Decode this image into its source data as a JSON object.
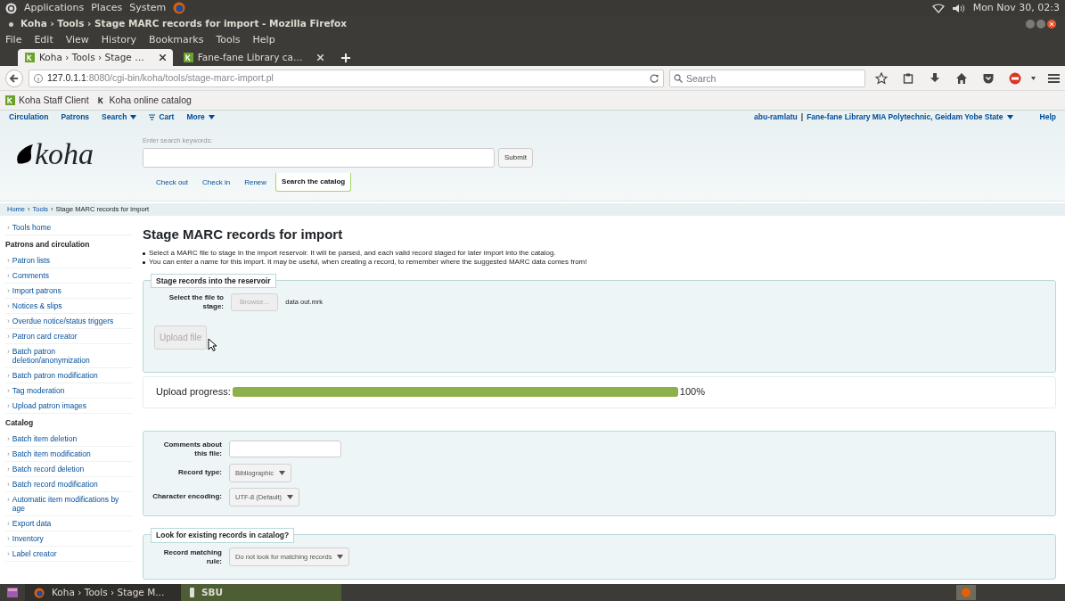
{
  "top_panel": {
    "menus": [
      "Applications",
      "Places",
      "System"
    ],
    "clock": "Mon Nov 30, 02:3"
  },
  "window": {
    "title": "Koha › Tools › Stage MARC records for import - Mozilla Firefox"
  },
  "menu_bar": [
    "File",
    "Edit",
    "View",
    "History",
    "Bookmarks",
    "Tools",
    "Help"
  ],
  "browser_tabs": [
    {
      "label": "Koha › Tools › Stage …",
      "selected": true
    },
    {
      "label": "Fane-fane Library ca…",
      "selected": false
    }
  ],
  "address_bar": {
    "host": "127.0.1.1",
    "path": ":8080/cgi-bin/koha/tools/stage-marc-import.pl"
  },
  "search_bar": {
    "placeholder": "Search"
  },
  "bookmarks": [
    "Koha Staff Client",
    "Koha online catalog"
  ],
  "koha_nav": {
    "left": [
      {
        "label": "Circulation",
        "has_menu": false,
        "kind": "link"
      },
      {
        "label": "Patrons",
        "has_menu": false,
        "kind": "link"
      },
      {
        "label": "Search",
        "has_menu": true,
        "kind": "link"
      },
      {
        "label": "Cart",
        "has_menu": false,
        "kind": "cart"
      },
      {
        "label": "More",
        "has_menu": true,
        "kind": "link"
      }
    ],
    "user": "abu-ramlatu",
    "separator": "|",
    "library": "Fane-fane Library MIA Polytechnic, Geidam Yobe State",
    "help": "Help"
  },
  "header": {
    "logo": "koha",
    "search_label": "Enter search keywords:",
    "submit": "Submit",
    "tabs": [
      {
        "label": "Check out",
        "selected": false
      },
      {
        "label": "Check in",
        "selected": false
      },
      {
        "label": "Renew",
        "selected": false
      },
      {
        "label": "Search the catalog",
        "selected": true
      }
    ]
  },
  "breadcrumb": {
    "separator": "›",
    "items": [
      "Home",
      "Tools",
      "Stage MARC records for import"
    ]
  },
  "sidebar": {
    "marker": "›",
    "items": [
      {
        "kind": "link",
        "label": "Tools home"
      },
      {
        "kind": "heading",
        "label": "Patrons and circulation"
      },
      {
        "kind": "link",
        "label": "Patron lists"
      },
      {
        "kind": "link",
        "label": "Comments"
      },
      {
        "kind": "link",
        "label": "Import patrons"
      },
      {
        "kind": "link",
        "label": "Notices & slips"
      },
      {
        "kind": "link",
        "label": "Overdue notice/status triggers"
      },
      {
        "kind": "link",
        "label": "Patron card creator"
      },
      {
        "kind": "link",
        "label": "Batch patron deletion/anonymization"
      },
      {
        "kind": "link",
        "label": "Batch patron modification"
      },
      {
        "kind": "link",
        "label": "Tag moderation"
      },
      {
        "kind": "link",
        "label": "Upload patron images"
      },
      {
        "kind": "heading",
        "label": "Catalog"
      },
      {
        "kind": "link",
        "label": "Batch item deletion"
      },
      {
        "kind": "link",
        "label": "Batch item modification"
      },
      {
        "kind": "link",
        "label": "Batch record deletion"
      },
      {
        "kind": "link",
        "label": "Batch record modification"
      },
      {
        "kind": "link",
        "label": "Automatic item modifications by age"
      },
      {
        "kind": "link",
        "label": "Export data"
      },
      {
        "kind": "link",
        "label": "Inventory"
      },
      {
        "kind": "link",
        "label": "Label creator"
      }
    ]
  },
  "main": {
    "title": "Stage MARC records for import",
    "notes": [
      "Select a MARC file to stage in the import reservoir. It will be parsed, and each valid record staged for later import into the catalog.",
      "You can enter a name for this import. It may be useful, when creating a record, to remember where the suggested MARC data comes from!"
    ],
    "stage_fieldset": {
      "legend": "Stage records into the reservoir",
      "file_label": "Select the file to stage:",
      "browse": "Browse...",
      "file_name": "data out.mrk",
      "upload": {
        "label": "Upload file",
        "disabled": true
      }
    },
    "progress": {
      "label": "Upload progress:",
      "level": 1,
      "reading": "100%"
    },
    "options": [
      {
        "kind": "input",
        "label": "Comments about this file:"
      },
      {
        "kind": "select",
        "label": "Record type:",
        "value": "Bibliographic"
      },
      {
        "kind": "select",
        "label": "Character encoding:",
        "value": "UTF-8 (Default)"
      }
    ],
    "match_fieldset": {
      "legend": "Look for existing records in catalog?",
      "fields": [
        {
          "kind": "select",
          "label": "Record matching rule:",
          "value": "Do not look for matching records"
        }
      ]
    }
  },
  "taskbar": [
    {
      "label": "Koha › Tools › Stage M...",
      "kind": "firefox"
    },
    {
      "label": "SBU",
      "kind": "terminal"
    }
  ]
}
